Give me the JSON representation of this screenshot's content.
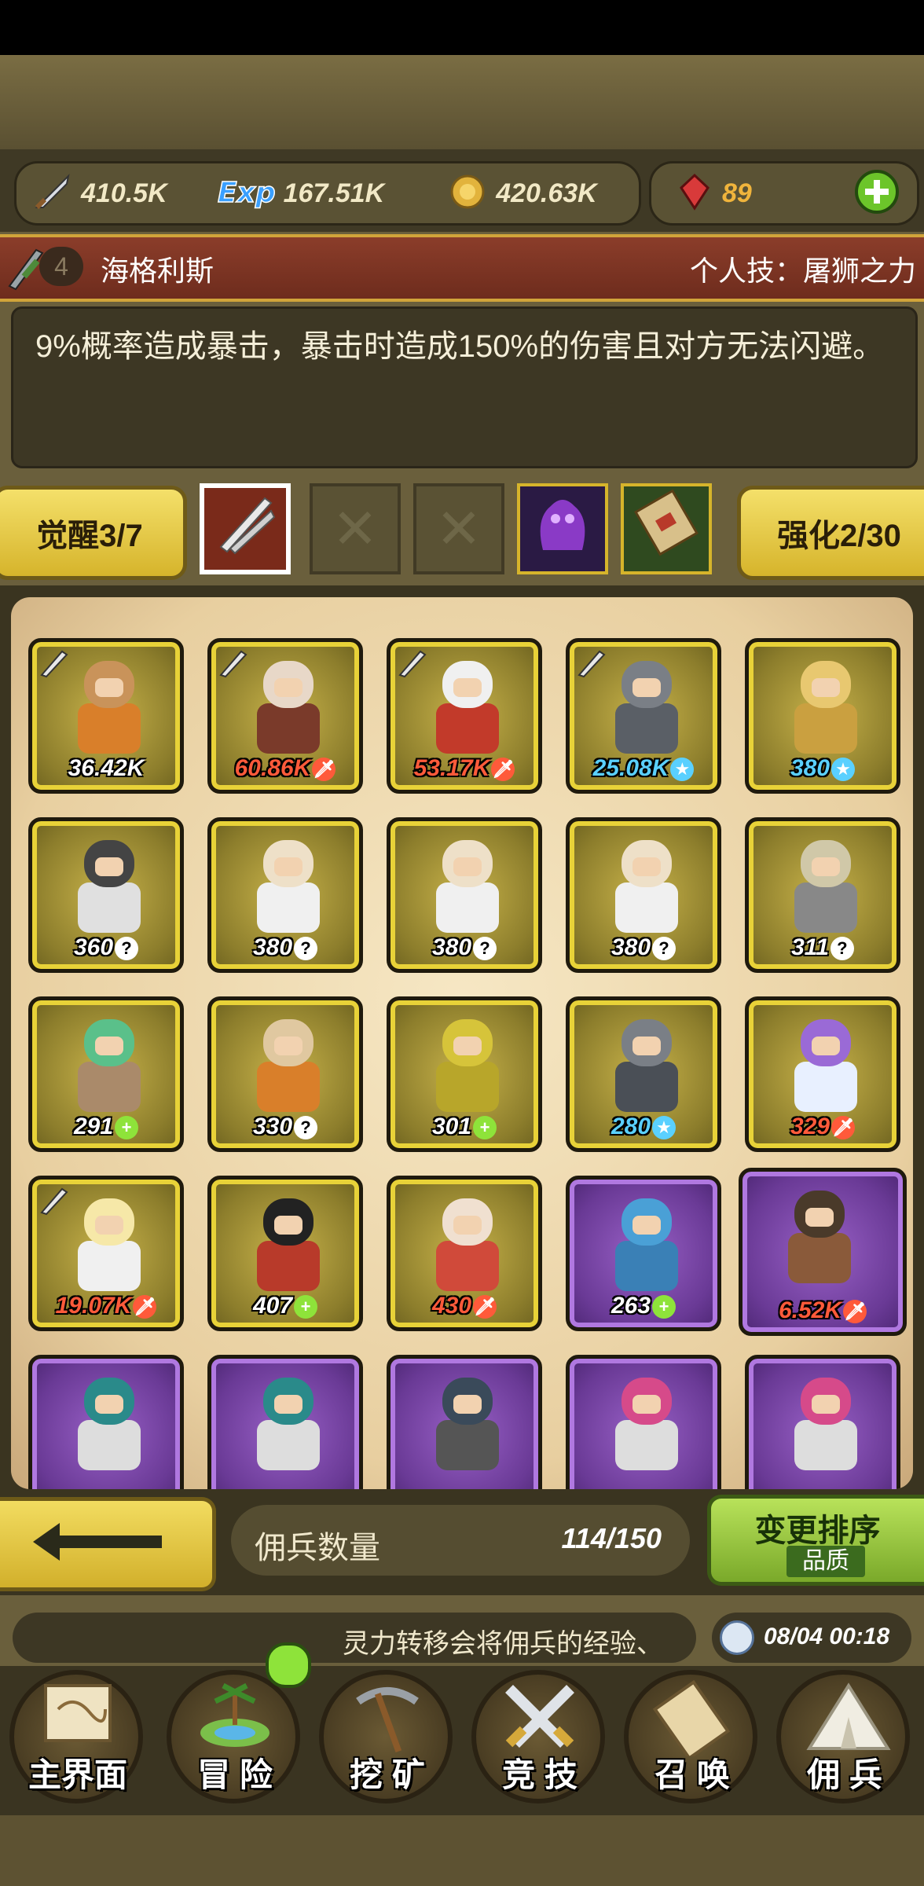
{
  "resources": {
    "attack": "410.5K",
    "exp": "167.51K",
    "gold": "420.63K",
    "gems": "89"
  },
  "hero": {
    "level": "4",
    "name": "海格利斯",
    "skill": "个人技：屠狮之力",
    "description": "9%概率造成暴击，暴击时造成150%的伤害且对方无法闪避。"
  },
  "awaken": {
    "label": "觉醒3/7"
  },
  "enhance": {
    "label": "强化2/30"
  },
  "slots": {
    "empty1": "✕",
    "empty2": "✕"
  },
  "mercenaries": [
    {
      "value": "36.42K",
      "color": "white",
      "badge": ""
    },
    {
      "value": "60.86K",
      "color": "red",
      "badge": "🗡"
    },
    {
      "value": "53.17K",
      "color": "red",
      "badge": "🗡"
    },
    {
      "value": "25.08K",
      "color": "blue",
      "badge": "★"
    },
    {
      "value": "380",
      "color": "blue",
      "badge": "★"
    },
    {
      "value": "360",
      "color": "white",
      "badge": "?"
    },
    {
      "value": "380",
      "color": "white",
      "badge": "?"
    },
    {
      "value": "380",
      "color": "white",
      "badge": "?"
    },
    {
      "value": "380",
      "color": "white",
      "badge": "?"
    },
    {
      "value": "311",
      "color": "white",
      "badge": "?"
    },
    {
      "value": "291",
      "color": "white",
      "badge": "+"
    },
    {
      "value": "330",
      "color": "white",
      "badge": "?"
    },
    {
      "value": "301",
      "color": "white",
      "badge": "+"
    },
    {
      "value": "280",
      "color": "blue",
      "badge": "★"
    },
    {
      "value": "329",
      "color": "red",
      "badge": "🗡"
    },
    {
      "value": "19.07K",
      "color": "red",
      "badge": "🗡"
    },
    {
      "value": "407",
      "color": "white",
      "badge": "+"
    },
    {
      "value": "430",
      "color": "red",
      "badge": "🗡"
    },
    {
      "value": "263",
      "color": "white",
      "badge": "+"
    },
    {
      "value": "6.52K",
      "color": "red",
      "badge": "🗡"
    }
  ],
  "footer": {
    "count_label": "佣兵数量",
    "count_value": "114/150",
    "sort_title": "变更排序",
    "sort_sub": "品质",
    "ticker": "灵力转移会将佣兵的经验、",
    "datetime": "08/04 00:18"
  },
  "nav": {
    "home": "主界面",
    "adventure": "冒 险",
    "mining": "挖 矿",
    "arena": "竞 技",
    "summon": "召 唤",
    "mercenary": "佣 兵"
  }
}
